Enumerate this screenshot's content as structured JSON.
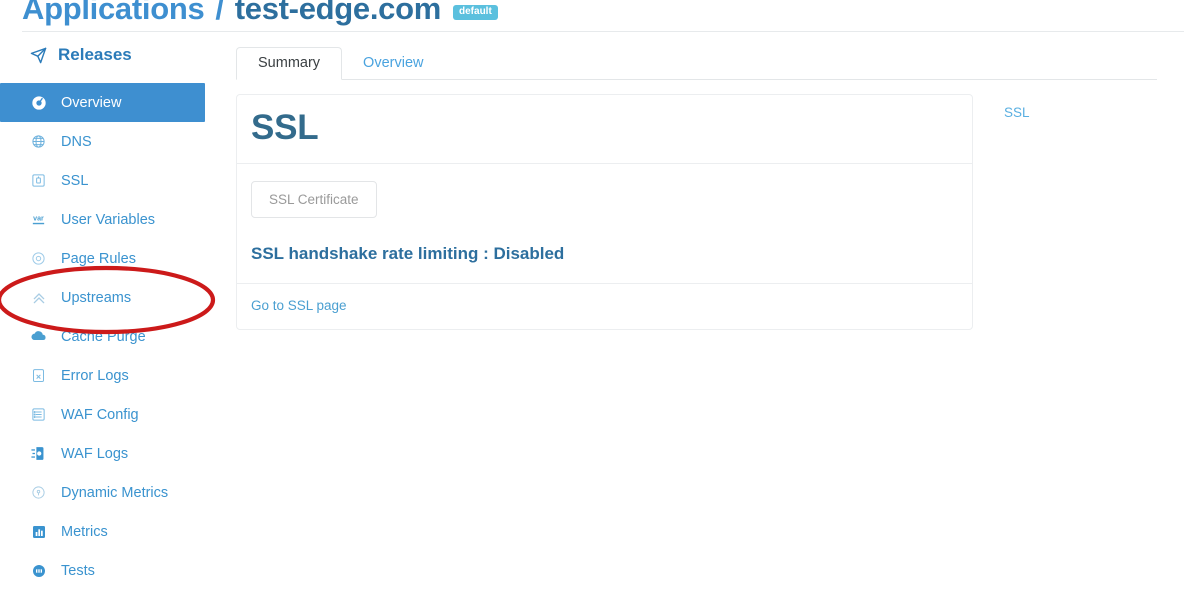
{
  "header": {
    "breadcrumb_root": "Applications",
    "breadcrumb_separator": "/",
    "breadcrumb_current": "test-edge.com",
    "badge": "default"
  },
  "sidebar": {
    "title": "Releases",
    "title_icon": "send-icon",
    "items": [
      {
        "label": "Overview",
        "icon": "dashboard-icon",
        "active": true
      },
      {
        "label": "DNS",
        "icon": "globe-icon",
        "active": false
      },
      {
        "label": "SSL",
        "icon": "certificate-icon",
        "active": false
      },
      {
        "label": "User Variables",
        "icon": "var-icon",
        "active": false
      },
      {
        "label": "Page Rules",
        "icon": "target-icon",
        "active": false
      },
      {
        "label": "Upstreams",
        "icon": "chevrons-up-icon",
        "active": false
      },
      {
        "label": "Cache Purge",
        "icon": "cloud-icon",
        "active": false
      },
      {
        "label": "Error Logs",
        "icon": "file-x-icon",
        "active": false
      },
      {
        "label": "WAF Config",
        "icon": "list-icon",
        "active": false
      },
      {
        "label": "WAF Logs",
        "icon": "shield-log-icon",
        "active": false
      },
      {
        "label": "Dynamic Metrics",
        "icon": "pin-circle-icon",
        "active": false
      },
      {
        "label": "Metrics",
        "icon": "bar-chart-icon",
        "active": false
      },
      {
        "label": "Tests",
        "icon": "test-circle-icon",
        "active": false
      }
    ]
  },
  "tabs": [
    {
      "label": "Summary",
      "active": true
    },
    {
      "label": "Overview",
      "active": false
    }
  ],
  "main": {
    "card": {
      "title": "SSL",
      "certificate_button": "SSL Certificate",
      "status_line": "SSL handshake rate limiting : Disabled",
      "footer_link": "Go to SSL page"
    }
  },
  "right_rail": {
    "links": [
      {
        "label": "SSL"
      }
    ]
  },
  "annotation": {
    "shape": "ellipse",
    "color": "#cc1a1a",
    "targets": "Upstreams"
  },
  "colors": {
    "accent_blue": "#3e8fd0",
    "link_blue": "#4aa3df",
    "heading_blue": "#336b8c",
    "badge_blue": "#5bc0de",
    "annotation_red": "#cc1a1a"
  }
}
